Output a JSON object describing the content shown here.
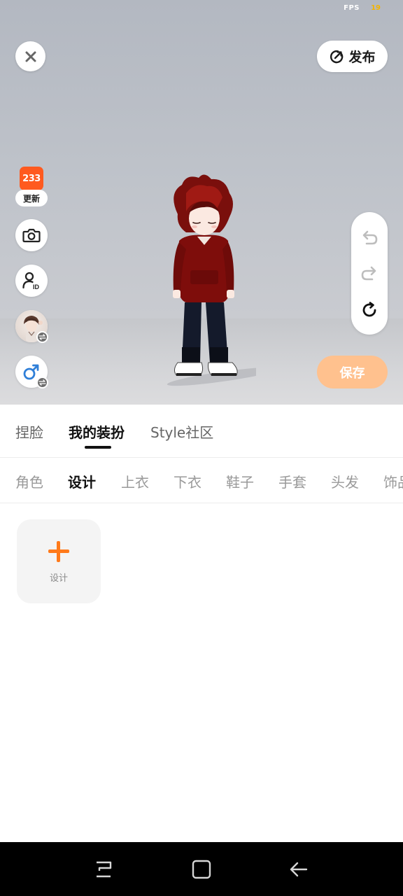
{
  "overlay": {
    "fps_label": "FPS",
    "fps_value": "19"
  },
  "header": {
    "close_icon": "close-icon",
    "publish_label": "发布",
    "publish_icon": "publish-icon"
  },
  "left_rail": {
    "update_logo": "233",
    "update_label": "更新",
    "buttons": [
      "camera-icon",
      "user-id-icon",
      "avatar-switch",
      "gender-switch-icon"
    ]
  },
  "right_rail": {
    "buttons": [
      "undo-icon",
      "redo-icon",
      "reset-icon"
    ]
  },
  "save_label": "保存",
  "main_tabs": [
    {
      "label": "捏脸",
      "active": false
    },
    {
      "label": "我的装扮",
      "active": true
    },
    {
      "label": "Style社区",
      "active": false
    }
  ],
  "sub_tabs": [
    {
      "label": "角色",
      "active": false
    },
    {
      "label": "设计",
      "active": true
    },
    {
      "label": "上衣",
      "active": false
    },
    {
      "label": "下衣",
      "active": false
    },
    {
      "label": "鞋子",
      "active": false
    },
    {
      "label": "手套",
      "active": false
    },
    {
      "label": "头发",
      "active": false
    },
    {
      "label": "饰品",
      "active": false
    }
  ],
  "design_card": {
    "label": "设计",
    "icon": "plus-icon"
  },
  "nav_bar": {
    "buttons": [
      "recent-apps-icon",
      "home-icon",
      "back-icon"
    ]
  },
  "colors": {
    "accent": "#ff7a1a",
    "save_button": "#ffc18e",
    "update_badge": "#ff5a1f",
    "gender_male": "#2f7fd8"
  }
}
